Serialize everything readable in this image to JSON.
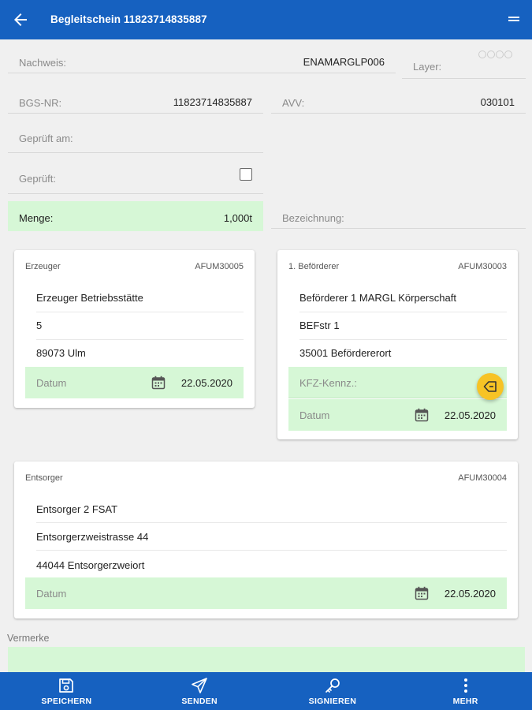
{
  "header": {
    "title": "Begleitschein 11823714835887"
  },
  "form": {
    "nachweis": {
      "label": "Nachweis:",
      "value": "ENAMARGLP006"
    },
    "layer": {
      "label": "Layer:"
    },
    "bgs_nr": {
      "label": "BGS-NR:",
      "value": "11823714835887"
    },
    "avv": {
      "label": "AVV:",
      "value": "030101"
    },
    "geprueft_am": {
      "label": "Geprüft am:"
    },
    "geprueft": {
      "label": "Geprüft:",
      "checked": false
    },
    "menge": {
      "label": "Menge:",
      "value": "1,000t"
    },
    "bezeichnung": {
      "label": "Bezeichnung:"
    }
  },
  "cards": {
    "erzeuger": {
      "title": "Erzeuger",
      "id": "AFUM30005",
      "lines": [
        "Erzeuger Betriebsstätte",
        "5",
        "89073 Ulm"
      ],
      "datum_label": "Datum",
      "datum_value": "22.05.2020"
    },
    "befoerderer": {
      "title": "1. Beförderer",
      "id": "AFUM30003",
      "lines": [
        "Beförderer 1 MARGL Körperschaft",
        "BEFstr 1",
        "35001 Befördererort"
      ],
      "kfz_label": "KFZ-Kennz.:",
      "datum_label": "Datum",
      "datum_value": "22.05.2020"
    },
    "entsorger": {
      "title": "Entsorger",
      "id": "AFUM30004",
      "lines": [
        "Entsorger 2 FSAT",
        "Entsorgerzweistrasse 44",
        "44044 Entsorgerzweiort"
      ],
      "datum_label": "Datum",
      "datum_value": "22.05.2020"
    }
  },
  "vermerke": {
    "label": "Vermerke"
  },
  "bottom_nav": [
    {
      "label": "SPEICHERN",
      "icon": "save-icon"
    },
    {
      "label": "SENDEN",
      "icon": "send-icon"
    },
    {
      "label": "SIGNIEREN",
      "icon": "key-icon"
    },
    {
      "label": "MEHR",
      "icon": "more-vert-icon"
    }
  ],
  "colors": {
    "primary": "#1661c0",
    "highlight_green": "#d6f7d6",
    "fab": "#f7c325"
  }
}
